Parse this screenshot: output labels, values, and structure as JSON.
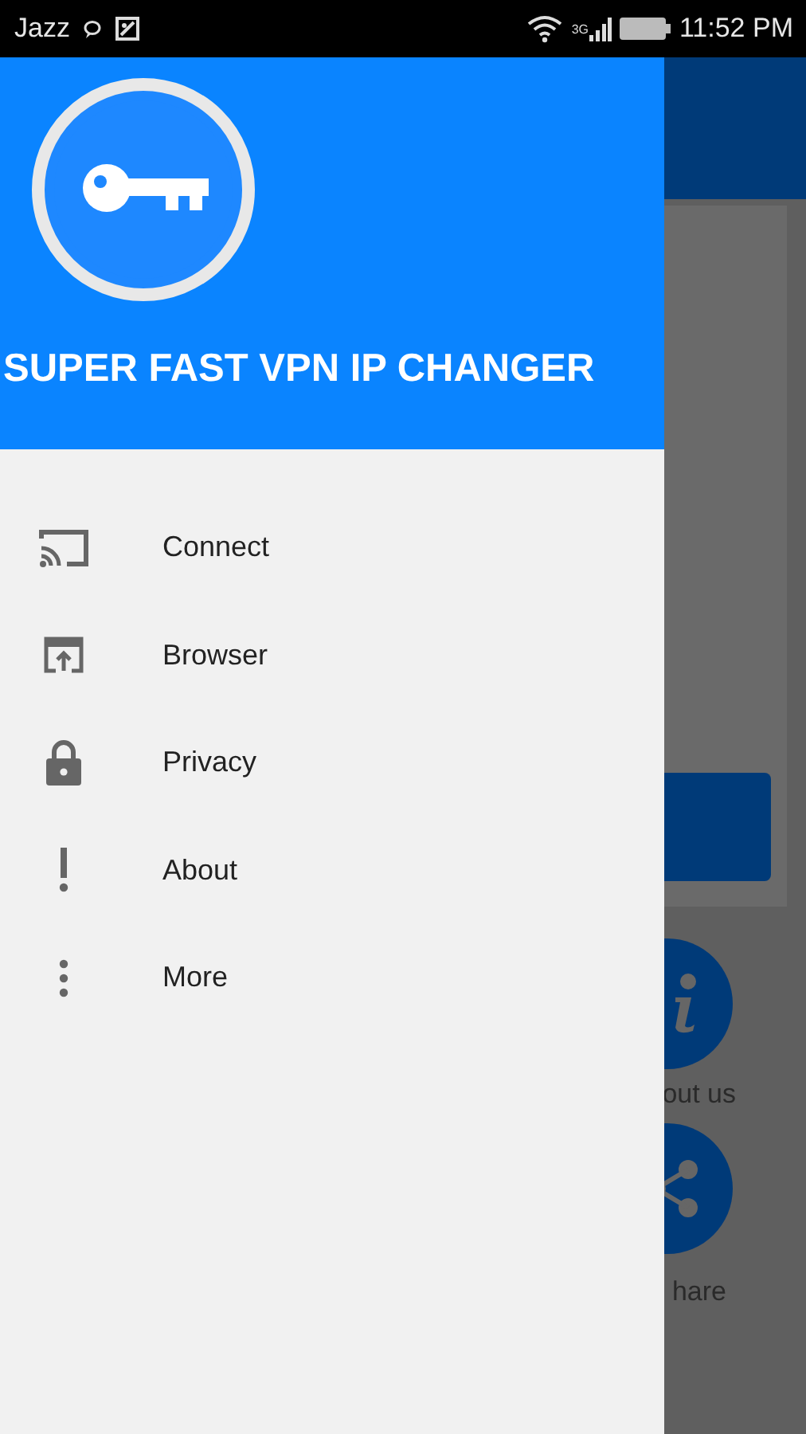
{
  "status_bar": {
    "carrier": "Jazz",
    "network": "3G",
    "time": "11:52 PM"
  },
  "drawer": {
    "title": "SUPER FAST VPN IP CHANGER",
    "items": [
      {
        "kind": "cast",
        "label": "Connect"
      },
      {
        "kind": "browser",
        "label": "Browser"
      },
      {
        "kind": "lock",
        "label": "Privacy"
      },
      {
        "kind": "alert",
        "label": "About"
      },
      {
        "kind": "more",
        "label": "More"
      }
    ]
  },
  "background": {
    "actions": [
      {
        "kind": "info",
        "label": "out us"
      },
      {
        "kind": "share",
        "label": "hare"
      }
    ]
  }
}
